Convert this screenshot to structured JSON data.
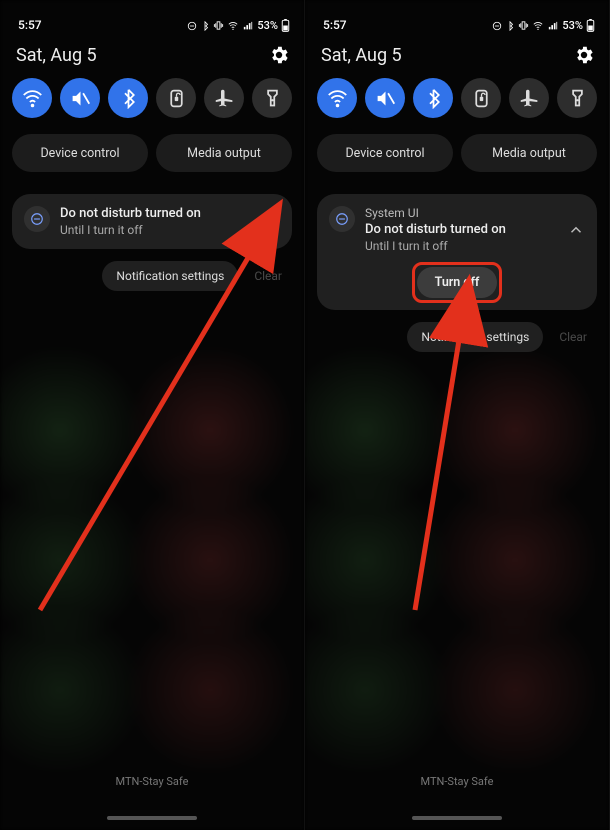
{
  "status": {
    "time": "5:57",
    "battery_pct": "53%"
  },
  "header": {
    "date": "Sat, Aug 5"
  },
  "quick_settings": {
    "items": [
      {
        "name": "wifi",
        "on": true
      },
      {
        "name": "mute",
        "on": true
      },
      {
        "name": "bluetooth",
        "on": true
      },
      {
        "name": "lock",
        "on": false
      },
      {
        "name": "airplane",
        "on": false
      },
      {
        "name": "flashlight",
        "on": false
      }
    ]
  },
  "pills": {
    "device_control": "Device control",
    "media_output": "Media output"
  },
  "left_notification": {
    "title": "Do not disturb turned on",
    "subtitle": "Until I turn it off"
  },
  "right_notification": {
    "app": "System UI",
    "title": "Do not disturb turned on",
    "subtitle": "Until I turn it off",
    "action": "Turn off"
  },
  "footer": {
    "notification_settings": "Notification settings",
    "clear": "Clear",
    "carrier": "MTN-Stay Safe"
  }
}
